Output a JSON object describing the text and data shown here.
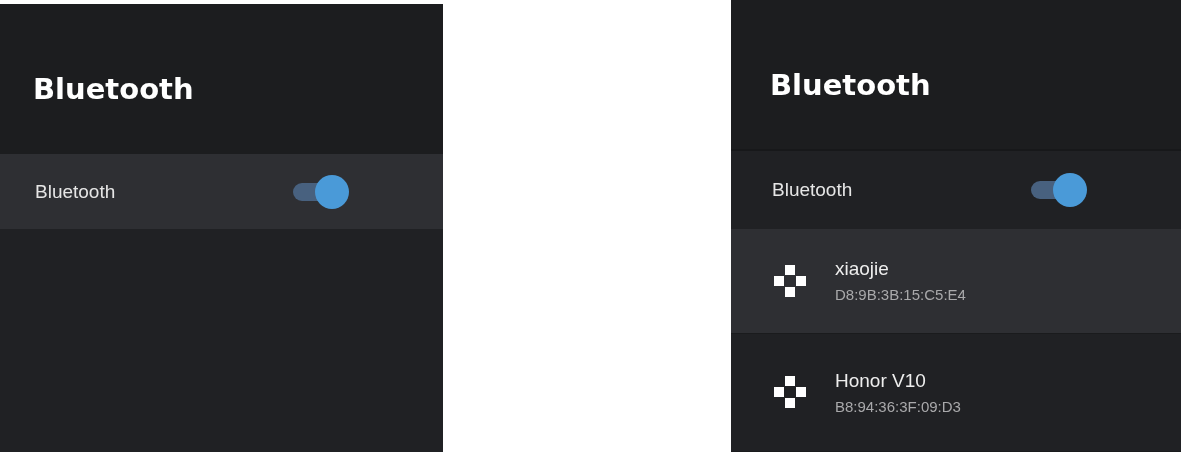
{
  "panels": [
    {
      "title": "Bluetooth",
      "toggle_row": {
        "label": "Bluetooth",
        "on": true,
        "selected": true
      }
    },
    {
      "title": "Bluetooth",
      "toggle_row": {
        "label": "Bluetooth",
        "on": true,
        "selected": false
      },
      "devices": [
        {
          "name": "xiaojie",
          "address": "D8:9B:3B:15:C5:E4",
          "selected": true
        },
        {
          "name": "Honor V10",
          "address": "B8:94:36:3F:09:D3",
          "selected": false
        }
      ]
    }
  ]
}
